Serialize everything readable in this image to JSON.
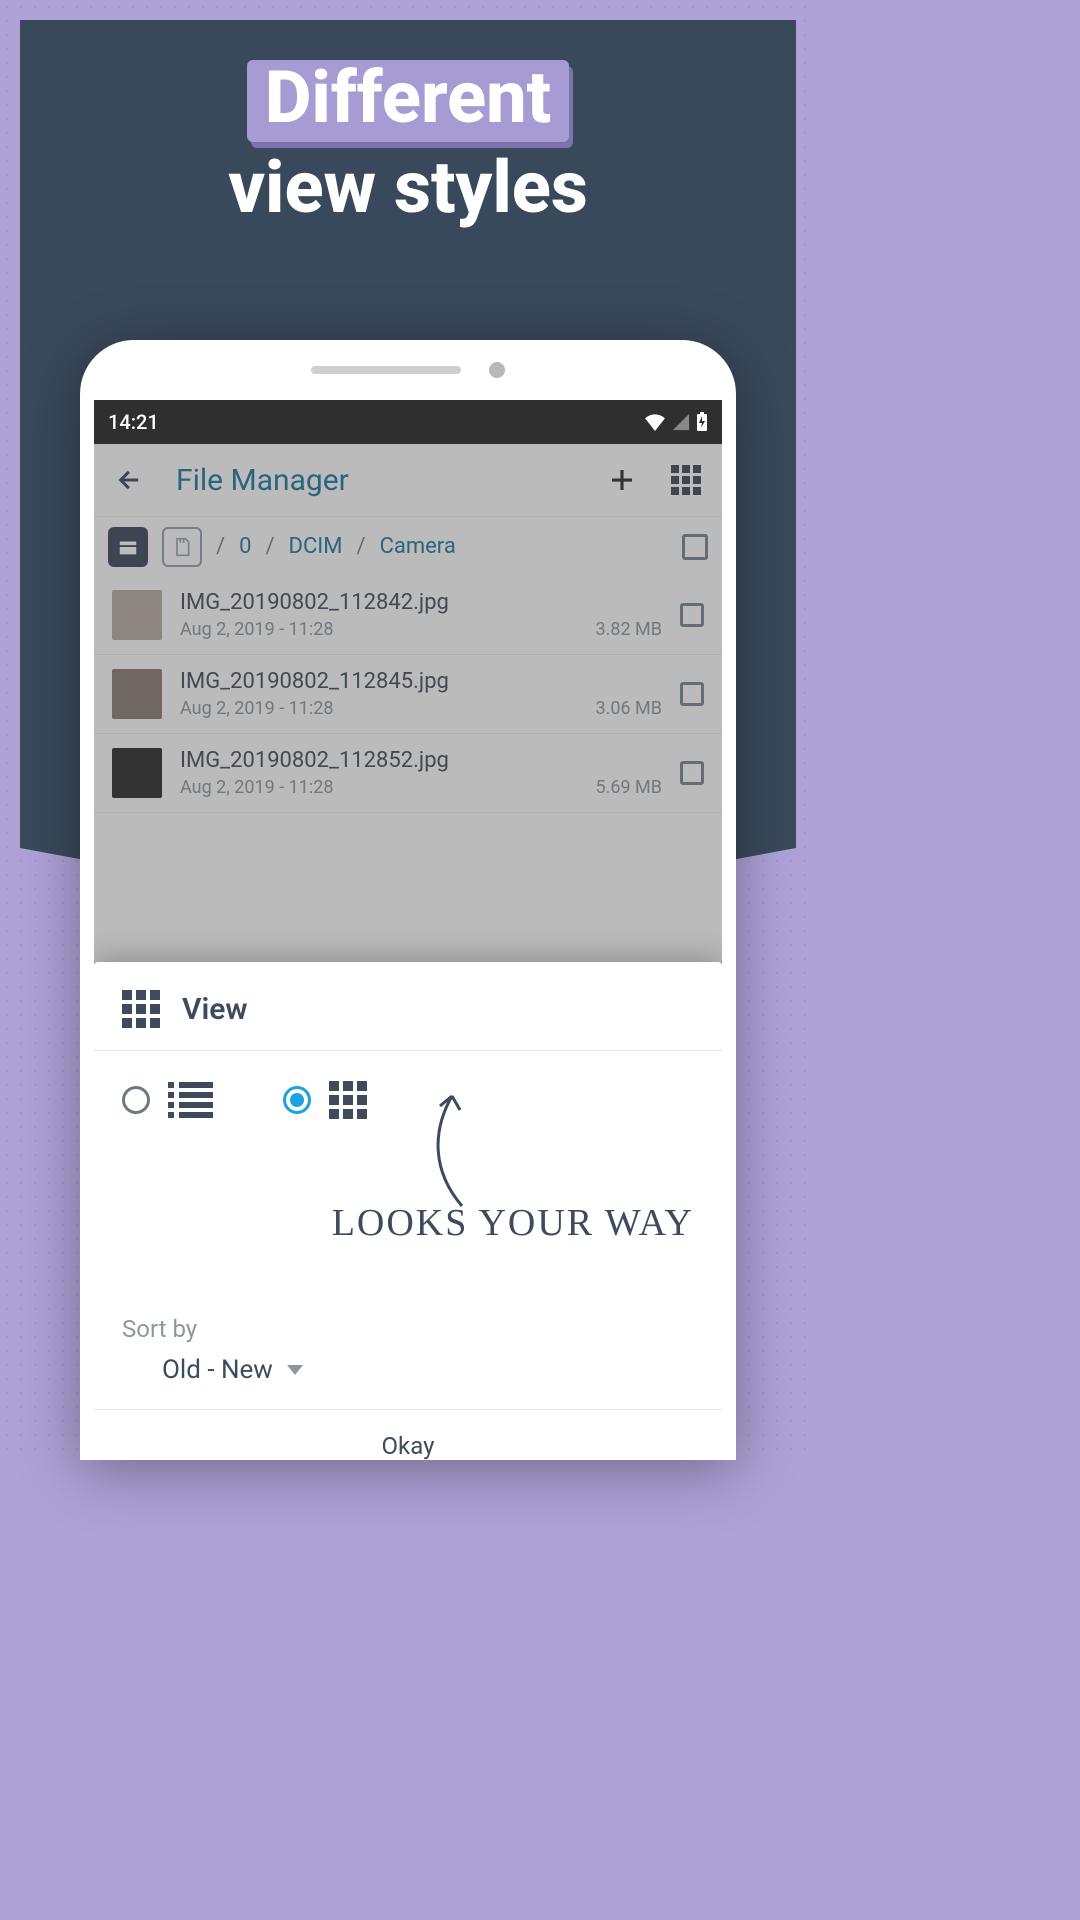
{
  "hero": {
    "highlight": "Different",
    "subtitle": "view styles"
  },
  "statusbar": {
    "time": "14:21"
  },
  "appbar": {
    "title": "File Manager"
  },
  "breadcrumb": {
    "items": [
      "0",
      "DCIM",
      "Camera"
    ],
    "sep": "/"
  },
  "files": [
    {
      "name": "IMG_20190802_112842.jpg",
      "date": "Aug 2, 2019 - 11:28",
      "size": "3.82 MB"
    },
    {
      "name": "IMG_20190802_112845.jpg",
      "date": "Aug 2, 2019 - 11:28",
      "size": "3.06 MB"
    },
    {
      "name": "IMG_20190802_112852.jpg",
      "date": "Aug 2, 2019 - 11:28",
      "size": "5.69 MB"
    }
  ],
  "sheet": {
    "title": "View",
    "sort_label": "Sort by",
    "sort_value": "Old - New",
    "confirm": "Okay",
    "callout": "LOOKS YOUR WAY"
  }
}
